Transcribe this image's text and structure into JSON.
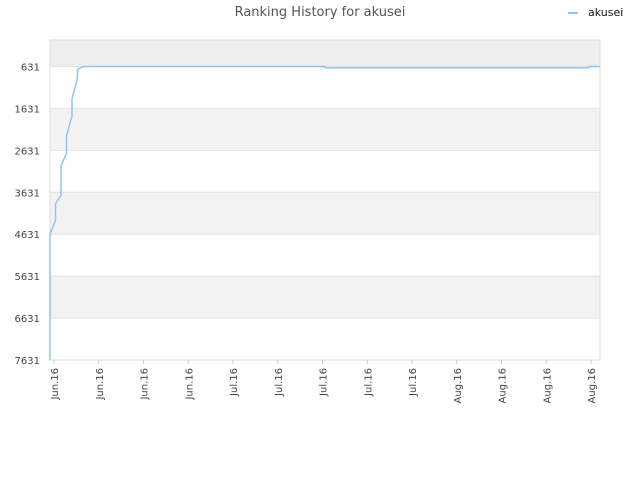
{
  "chart_data": {
    "type": "line",
    "title": "Ranking History for akusei",
    "xlabel": "",
    "ylabel": "",
    "y_inverted": true,
    "ylim": [
      7631,
      0
    ],
    "y_ticks": [
      631,
      1631,
      2631,
      3631,
      4631,
      5631,
      6631,
      7631
    ],
    "x_tick_labels": [
      "Jun.16",
      "Jun.16",
      "Jun.16",
      "Jun.16",
      "Jul.16",
      "Jul.16",
      "Jul.16",
      "Jul.16",
      "Jul.16",
      "Aug.16",
      "Aug.16",
      "Aug.16",
      "Aug.16"
    ],
    "grid": true,
    "legend_position": "top-right",
    "colors": {
      "line": "#90c4f2",
      "band": "#f2f2f2",
      "top_band": "#eeeeee"
    },
    "series": [
      {
        "name": "akusei",
        "points": [
          [
            0.0,
            7631
          ],
          [
            0.0,
            4631
          ],
          [
            0.01,
            4300
          ],
          [
            0.01,
            3900
          ],
          [
            0.02,
            3700
          ],
          [
            0.02,
            3000
          ],
          [
            0.03,
            2700
          ],
          [
            0.03,
            2300
          ],
          [
            0.04,
            1800
          ],
          [
            0.04,
            1400
          ],
          [
            0.05,
            900
          ],
          [
            0.05,
            700
          ],
          [
            0.06,
            631
          ],
          [
            0.08,
            631
          ],
          [
            0.5,
            631
          ],
          [
            0.5,
            660
          ],
          [
            0.98,
            660
          ],
          [
            0.98,
            631
          ],
          [
            1.0,
            631
          ]
        ]
      }
    ]
  }
}
